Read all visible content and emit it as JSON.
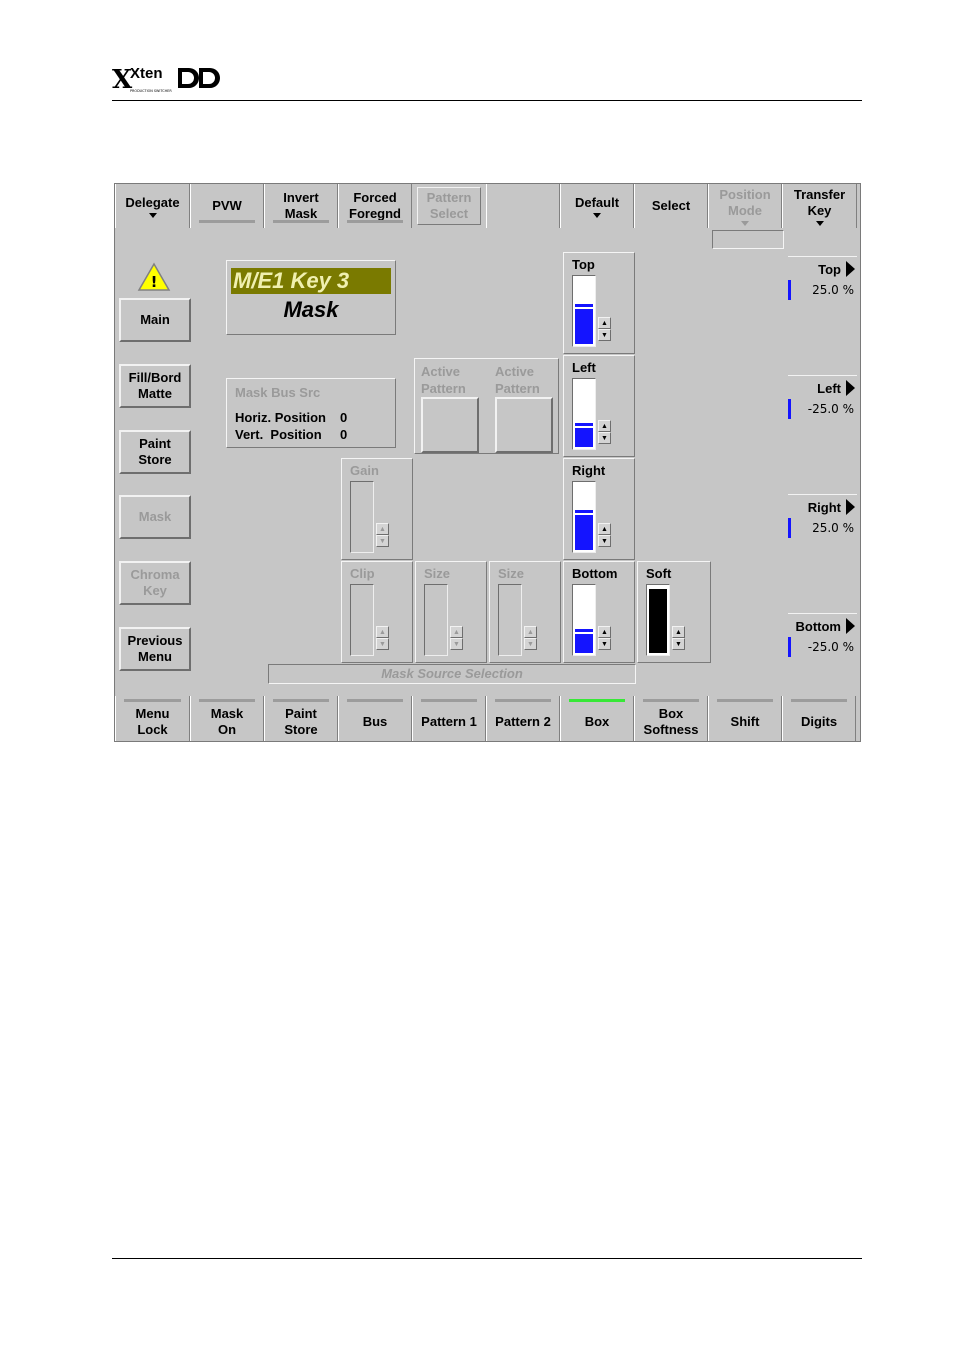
{
  "logo": {
    "word": "Xten",
    "suffix": "DD",
    "tagline": "PRODUCTION SWITCHER"
  },
  "screen": {
    "top_bar": [
      {
        "label": "Delegate",
        "caret": true
      },
      {
        "label": "PVW",
        "bar": true
      },
      {
        "label": "Invert\nMask",
        "bar": true
      },
      {
        "label": "Forced\nForegnd",
        "bar": true
      },
      {
        "label": "Pattern\nSelect",
        "dim": true,
        "boxed": true
      },
      {
        "label": ""
      },
      {
        "label": "Default",
        "caret": true
      },
      {
        "label": "Select"
      },
      {
        "label": "Position\nMode",
        "dim": true,
        "caret": true
      },
      {
        "label": "Transfer\nKey",
        "caret": true
      }
    ],
    "side_menu": [
      {
        "label": "Main"
      },
      {
        "label": "Fill/Bord\nMatte"
      },
      {
        "label": "Paint\nStore"
      },
      {
        "label": "Mask",
        "dim": true
      },
      {
        "label": "Chroma\nKey",
        "dim": true
      },
      {
        "label": "Previous\nMenu"
      }
    ],
    "title": {
      "line1": "M/E1 Key 3",
      "line2": "Mask"
    },
    "info": {
      "heading": "Mask Bus Src",
      "horiz_label": "Horiz. Position",
      "horiz_value": "0",
      "vert_label": "Vert.  Position",
      "vert_value": "0"
    },
    "active_pattern_1": "Active\nPattern",
    "active_pattern_2": "Active\nPattern",
    "faders": {
      "top": {
        "label": "Top",
        "level": 0.62
      },
      "left": {
        "label": "Left",
        "level": 0.38
      },
      "right": {
        "label": "Right",
        "level": 0.62
      },
      "bottom": {
        "label": "Bottom",
        "level": 0.38
      },
      "soft": {
        "label": "Soft",
        "level": 1.0
      },
      "gain": {
        "label": "Gain"
      },
      "clip": {
        "label": "Clip"
      },
      "size1": {
        "label": "Size"
      },
      "size2": {
        "label": "Size"
      }
    },
    "mask_source_selection": "Mask Source Selection",
    "right_params": [
      {
        "label": "Top",
        "value": "25.0 %"
      },
      {
        "label": "Left",
        "value": "-25.0 %"
      },
      {
        "label": "Right",
        "value": "25.0 %"
      },
      {
        "label": "Bottom",
        "value": "-25.0 %"
      }
    ],
    "bottom_bar": [
      {
        "label": "Menu\nLock"
      },
      {
        "label": "Mask\nOn"
      },
      {
        "label": "Paint\nStore"
      },
      {
        "label": "Bus"
      },
      {
        "label": "Pattern 1"
      },
      {
        "label": "Pattern 2"
      },
      {
        "label": "Box",
        "active": true
      },
      {
        "label": "Box\nSoftness"
      },
      {
        "label": "Shift"
      },
      {
        "label": "Digits"
      }
    ],
    "colors": {
      "panel": "#c6c6c6",
      "title_bg": "#7a7a00",
      "title_fg": "#f0f0b0",
      "fader": "#1414ff",
      "active_bar": "#37e837"
    }
  }
}
